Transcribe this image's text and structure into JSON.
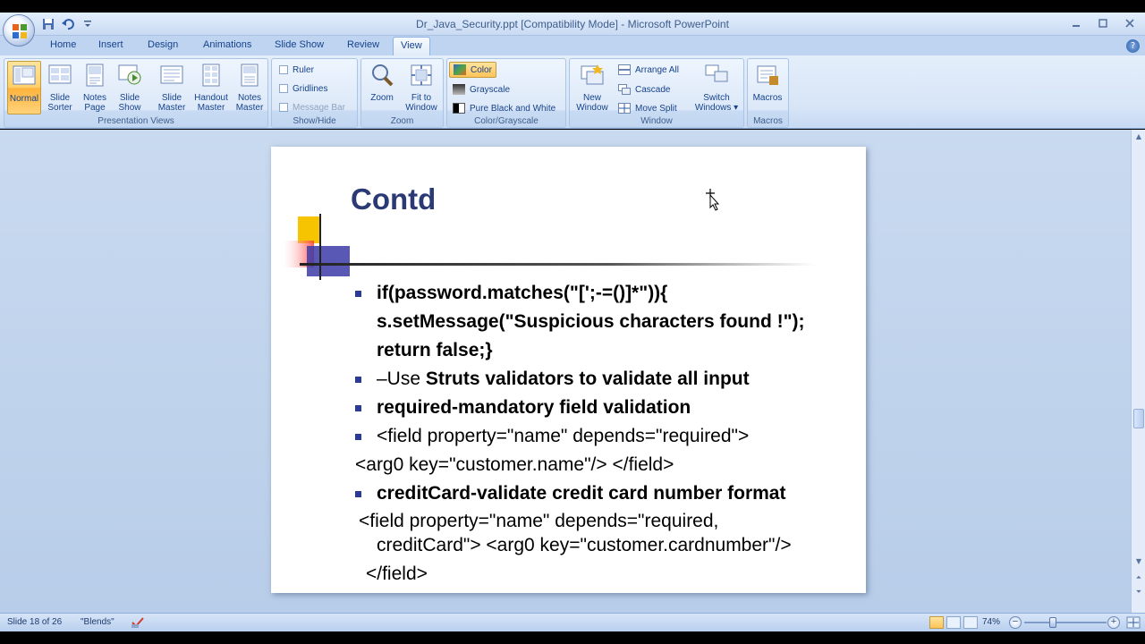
{
  "window": {
    "title": "Dr_Java_Security.ppt [Compatibility Mode] - Microsoft PowerPoint",
    "controls": [
      "minimize-icon",
      "maximize-icon",
      "close-icon"
    ]
  },
  "quick_access": {
    "icons": [
      "save-icon",
      "undo-icon",
      "customize-dropdown-icon"
    ]
  },
  "tabs": [
    "Home",
    "Insert",
    "Design",
    "Animations",
    "Slide Show",
    "Review",
    "View"
  ],
  "active_tab": "View",
  "ribbon": {
    "presentation_views": {
      "label": "Presentation Views",
      "buttons": [
        {
          "line1": "Normal",
          "line2": ""
        },
        {
          "line1": "Slide",
          "line2": "Sorter"
        },
        {
          "line1": "Notes",
          "line2": "Page"
        },
        {
          "line1": "Slide",
          "line2": "Show"
        },
        {
          "line1": "Slide",
          "line2": "Master"
        },
        {
          "line1": "Handout",
          "line2": "Master"
        },
        {
          "line1": "Notes",
          "line2": "Master"
        }
      ]
    },
    "show_hide": {
      "label": "Show/Hide",
      "options": [
        "Ruler",
        "Gridlines",
        "Message Bar"
      ]
    },
    "zoom": {
      "label": "Zoom",
      "buttons": [
        {
          "line1": "Zoom",
          "line2": ""
        },
        {
          "line1": "Fit to",
          "line2": "Window"
        }
      ]
    },
    "color": {
      "label": "Color/Grayscale",
      "options": [
        "Color",
        "Grayscale",
        "Pure Black and White"
      ]
    },
    "window": {
      "label": "Window",
      "new_window": {
        "line1": "New",
        "line2": "Window"
      },
      "small": [
        "Arrange All",
        "Cascade",
        "Move Split"
      ],
      "switch": {
        "line1": "Switch",
        "line2": "Windows ▾"
      }
    },
    "macros": {
      "label": "Macros",
      "button": "Macros"
    }
  },
  "slide": {
    "title": "Contd",
    "lines": [
      {
        "text": "if(password.matches(\"[';-=()]*\")){",
        "bold": true,
        "bullet": true
      },
      {
        "text": "s.setMessage(\"Suspicious characters found !\");",
        "bold": true,
        "bullet": false
      },
      {
        "text": "return false;}",
        "bold": true,
        "bullet": false
      },
      {
        "text_plain": "–Use ",
        "text_bold": "Struts validators to validate all input",
        "bullet": true
      },
      {
        "text": "required-mandatory field validation",
        "bold": true,
        "bullet": true
      },
      {
        "text": " <field property=\"name\" depends=\"required\">",
        "bold": false,
        "bullet": true
      },
      {
        "text": "<arg0 key=\"customer.name\"/> </field>",
        "bold": false,
        "bullet": false
      },
      {
        "text": "creditCard-validate credit card number format",
        "bold": true,
        "bullet": true
      },
      {
        "text": "<field property=\"name\" depends=\"required,",
        "bold": false,
        "bullet": false
      },
      {
        "text": "creditCard\"> <arg0 key=\"customer.cardnumber\"/>",
        "bold": false,
        "bullet": false
      },
      {
        "text": "</field>",
        "bold": false,
        "bullet": false
      }
    ]
  },
  "status": {
    "slide_info": "Slide 18 of 26",
    "theme": "\"Blends\"",
    "zoom": "74%",
    "zoom_value": 74,
    "zoom_range": [
      10,
      400
    ]
  },
  "colors": {
    "title": "#2b3a74",
    "bullet": "#2b3a96",
    "ribbon": "#dce8f8",
    "workspace": "#c9daf0"
  }
}
